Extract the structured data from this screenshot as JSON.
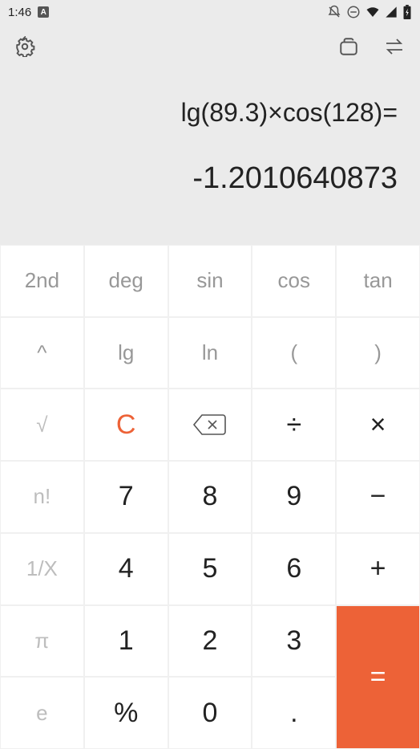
{
  "status": {
    "time": "1:46",
    "badge": "A"
  },
  "display": {
    "expression": "lg(89.3)×cos(128)=",
    "result": "-1.2010640873"
  },
  "keys": {
    "r0c0": "2nd",
    "r0c1": "deg",
    "r0c2": "sin",
    "r0c3": "cos",
    "r0c4": "tan",
    "r1c0": "^",
    "r1c1": "lg",
    "r1c2": "ln",
    "r1c3": "(",
    "r1c4": ")",
    "r2c0": "√",
    "r2c1": "C",
    "r2c3": "÷",
    "r2c4": "×",
    "r3c0": "n!",
    "r3c1": "7",
    "r3c2": "8",
    "r3c3": "9",
    "r3c4": "−",
    "r4c0": "1/X",
    "r4c1": "4",
    "r4c2": "5",
    "r4c3": "6",
    "r4c4": "+",
    "r5c0": "π",
    "r5c1": "1",
    "r5c2": "2",
    "r5c3": "3",
    "r5c4": "=",
    "r6c0": "e",
    "r6c1": "%",
    "r6c2": "0",
    "r6c3": "."
  }
}
